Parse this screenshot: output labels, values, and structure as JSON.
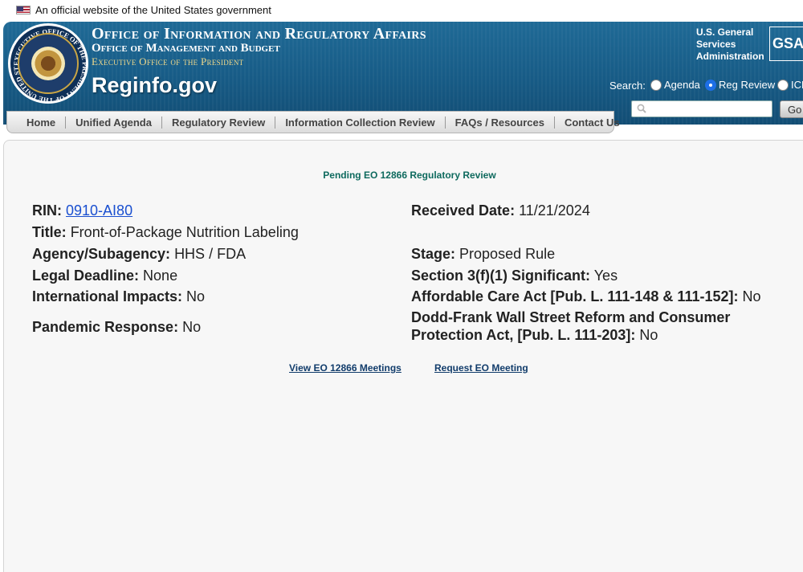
{
  "gov_banner": {
    "text": "An official website of the United States government"
  },
  "header": {
    "title_line1": "Office of Information and Regulatory Affairs",
    "title_line2": "Office of Management and Budget",
    "title_line3": "Executive Office of the President",
    "site_name": "Reginfo.gov",
    "gsa_text_lines": [
      "U.S. General",
      "Services",
      "Administration"
    ],
    "gsa_logo": "GSA",
    "seal_text": "EXECUTIVE OFFICE OF THE PRESIDENT OF THE UNITED STATES"
  },
  "search": {
    "label": "Search:",
    "options": [
      {
        "label": "Agenda",
        "selected": false
      },
      {
        "label": "Reg Review",
        "selected": true
      },
      {
        "label": "ICR",
        "selected": false
      }
    ],
    "input_value": "",
    "go_label": "Go"
  },
  "nav": {
    "items": [
      "Home",
      "Unified Agenda",
      "Regulatory Review",
      "Information Collection Review",
      "FAQs / Resources",
      "Contact Us"
    ]
  },
  "main": {
    "heading": "Pending EO 12866 Regulatory Review",
    "rin": {
      "label": "RIN:",
      "value": "0910-AI80"
    },
    "title": {
      "label": "Title:",
      "value": "Front-of-Package Nutrition Labeling"
    },
    "agency": {
      "label": "Agency/Subagency:",
      "value": "HHS / FDA"
    },
    "legal_deadline": {
      "label": "Legal Deadline:",
      "value": "None"
    },
    "international_impacts": {
      "label": "International Impacts:",
      "value": "No"
    },
    "pandemic_response": {
      "label": "Pandemic Response:",
      "value": "No"
    },
    "received_date": {
      "label": "Received Date:",
      "value": "11/21/2024"
    },
    "stage": {
      "label": "Stage:",
      "value": "Proposed Rule"
    },
    "section_3f1": {
      "label": "Section 3(f)(1) Significant:",
      "value": "Yes"
    },
    "aca": {
      "label": "Affordable Care Act [Pub. L. 111-148 & 111-152]:",
      "value": "No"
    },
    "dodd_frank": {
      "label_line1": "Dodd-Frank Wall Street Reform and Consumer",
      "label_line2": "Protection Act, [Pub. L. 111-203]:",
      "value": "No"
    },
    "links": {
      "view_meetings": "View EO 12866 Meetings",
      "request_meeting": "Request EO Meeting"
    }
  },
  "colors": {
    "header_blue": "#175b86",
    "heading_teal": "#0e6a5e",
    "link_blue": "#1a4fd0",
    "meeting_link": "#113c6b"
  }
}
